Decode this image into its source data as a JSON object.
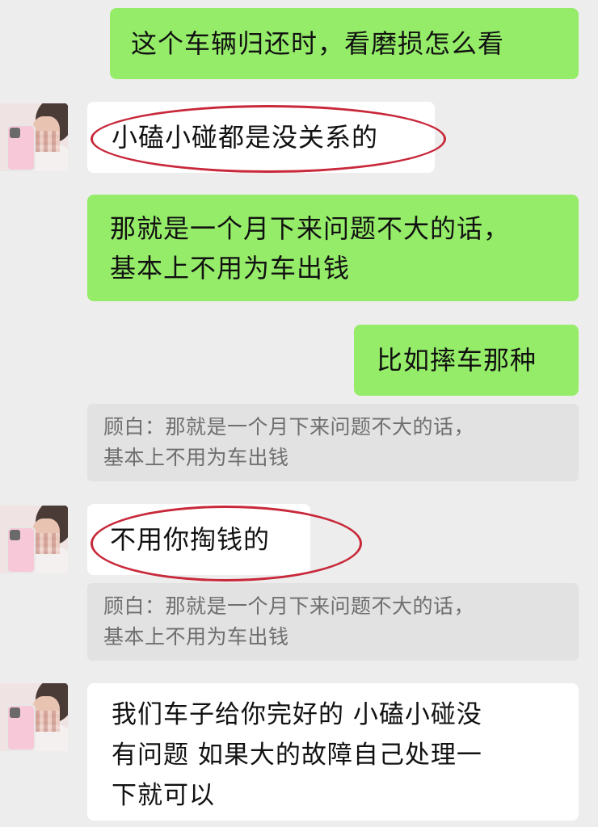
{
  "messages": {
    "m1": "这个车辆归还时，看磨损怎么看",
    "m2": "小磕小碰都是没关系的",
    "m3": [
      "那就是一个月下来问题不大的话，",
      "基本上不用为车出钱"
    ],
    "m4": "比如摔车那种",
    "q1": [
      "顾白：那就是一个月下来问题不大的话，",
      "基本上不用为车出钱"
    ],
    "m5": "不用你掏钱的",
    "q2": [
      "顾白：那就是一个月下来问题不大的话，",
      "基本上不用为车出钱"
    ],
    "m6": [
      "我们车子给你完好的 小磕小碰没",
      "有问题 如果大的故障自己处理一",
      "下就可以"
    ]
  },
  "colors": {
    "background": "#ededed",
    "outgoing_bubble": "#95ec69",
    "incoming_bubble": "#ffffff",
    "quote_bg": "#e2e2e2",
    "highlight_ring": "#c8283a"
  }
}
